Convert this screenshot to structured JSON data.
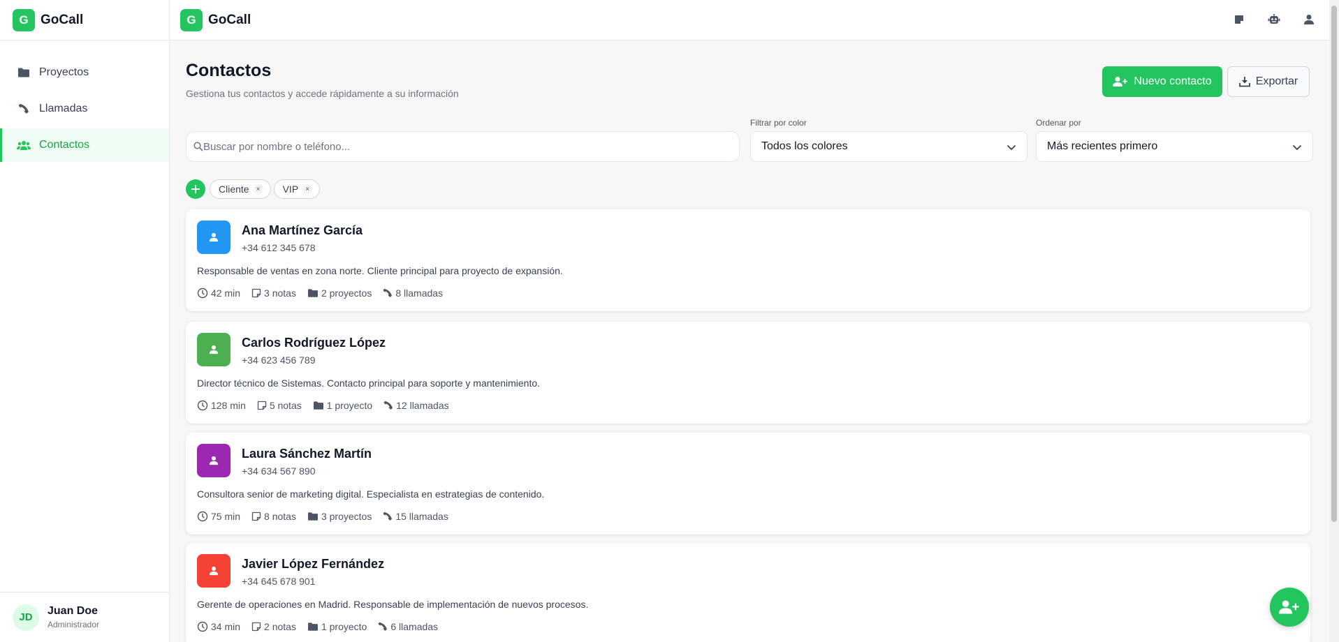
{
  "app": {
    "name": "GoCall",
    "logo_letter": "G"
  },
  "sidebar": {
    "items": [
      {
        "label": "Proyectos",
        "icon": "folder-icon"
      },
      {
        "label": "Llamadas",
        "icon": "phone-icon"
      },
      {
        "label": "Contactos",
        "icon": "users-icon",
        "active": true
      }
    ],
    "user": {
      "initials": "JD",
      "name": "Juan Doe",
      "role": "Administrador"
    }
  },
  "topbar": {
    "icons": [
      "note-icon",
      "robot-icon",
      "user-icon"
    ]
  },
  "page": {
    "title": "Contactos",
    "subtitle": "Gestiona tus contactos y accede rápidamente a su información",
    "new_contact_label": "Nuevo contacto",
    "export_label": "Exportar"
  },
  "filters": {
    "search_placeholder": "Buscar por nombre o teléfono...",
    "color_label": "Filtrar por color",
    "color_value": "Todos los colores",
    "sort_label": "Ordenar por",
    "sort_value": "Más recientes primero"
  },
  "tags": [
    "Cliente",
    "VIP"
  ],
  "contacts": [
    {
      "name": "Ana Martínez García",
      "phone": "+34 612 345 678",
      "description": "Responsable de ventas en zona norte. Cliente principal para proyecto de expansión.",
      "color": "#2196f3",
      "minutes": "42 min",
      "notes": "3 notas",
      "projects": "2 proyectos",
      "calls": "8 llamadas"
    },
    {
      "name": "Carlos Rodríguez López",
      "phone": "+34 623 456 789",
      "description": "Director técnico de Sistemas. Contacto principal para soporte y mantenimiento.",
      "color": "#4caf50",
      "minutes": "128 min",
      "notes": "5 notas",
      "projects": "1 proyecto",
      "calls": "12 llamadas"
    },
    {
      "name": "Laura Sánchez Martín",
      "phone": "+34 634 567 890",
      "description": "Consultora senior de marketing digital. Especialista en estrategias de contenido.",
      "color": "#9c27b0",
      "minutes": "75 min",
      "notes": "8 notas",
      "projects": "3 proyectos",
      "calls": "15 llamadas"
    },
    {
      "name": "Javier López Fernández",
      "phone": "+34 645 678 901",
      "description": "Gerente de operaciones en Madrid. Responsable de implementación de nuevos procesos.",
      "color": "#f44336",
      "minutes": "34 min",
      "notes": "2 notas",
      "projects": "1 proyecto",
      "calls": "6 llamadas"
    }
  ],
  "colors": {
    "accent": "#22c55e"
  }
}
